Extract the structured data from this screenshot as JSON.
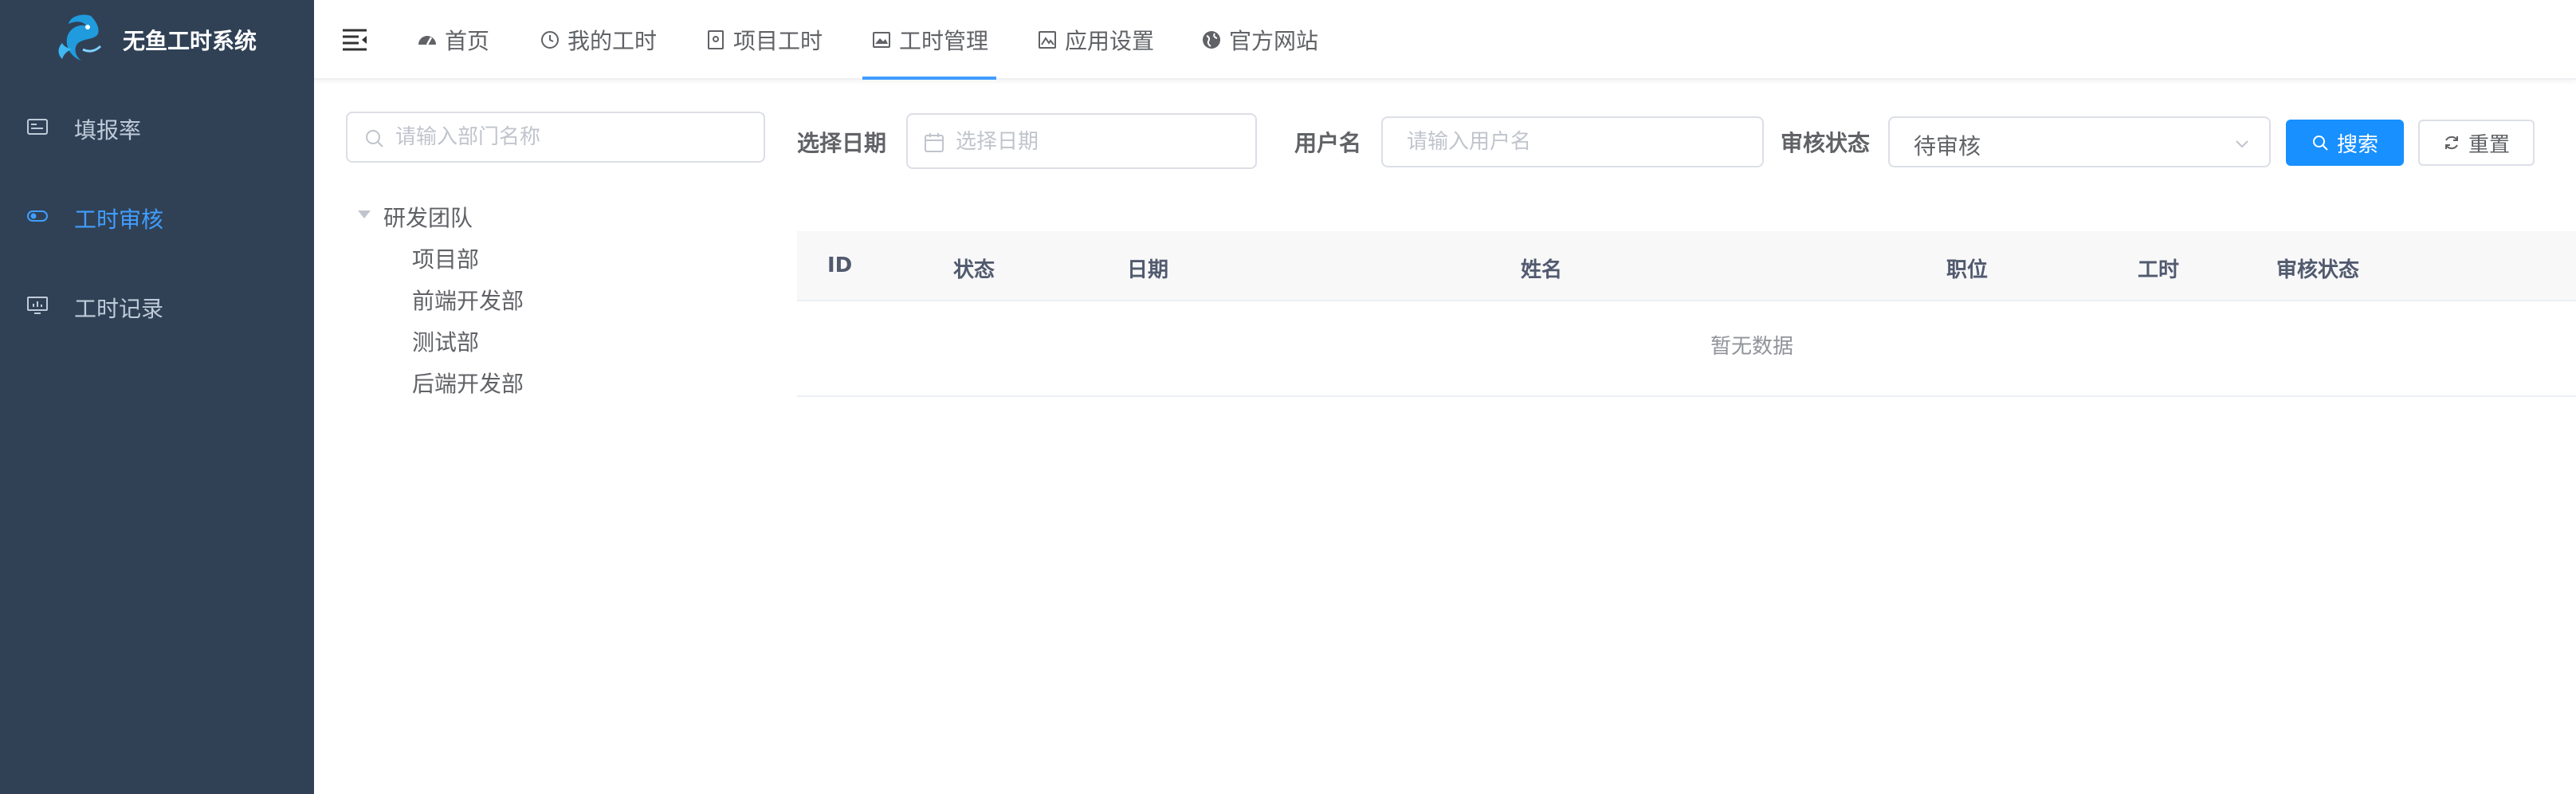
{
  "app": {
    "title": "无鱼工时系统",
    "logo_icon": "fish-logo-icon",
    "colors": {
      "sidebar_bg": "#304156",
      "sidebar_text": "#bfcbd9",
      "accent": "#409eff",
      "primary_button": "#1890ff"
    }
  },
  "sidebar": {
    "items": [
      {
        "label": "填报率",
        "icon": "report-icon",
        "active": false
      },
      {
        "label": "工时审核",
        "icon": "toggle-icon",
        "active": true
      },
      {
        "label": "工时记录",
        "icon": "monitor-chart-icon",
        "active": false
      }
    ]
  },
  "topnav": {
    "menu_toggle_icon": "hamburger-collapse-icon",
    "tabs": [
      {
        "label": "首页",
        "icon": "dashboard-icon",
        "active": false
      },
      {
        "label": "我的工时",
        "icon": "clock-icon",
        "active": false
      },
      {
        "label": "项目工时",
        "icon": "document-icon",
        "active": false
      },
      {
        "label": "工时管理",
        "icon": "image-icon",
        "active": true
      },
      {
        "label": "应用设置",
        "icon": "picture-icon",
        "active": false
      },
      {
        "label": "官方网站",
        "icon": "globe-icon",
        "active": false
      }
    ]
  },
  "dept_tree": {
    "search_placeholder": "请输入部门名称",
    "root": {
      "label": "研发团队",
      "expanded": true
    },
    "children": [
      "项目部",
      "前端开发部",
      "测试部",
      "后端开发部"
    ]
  },
  "filters": {
    "date_label": "选择日期",
    "date_placeholder": "选择日期",
    "username_label": "用户名",
    "username_placeholder": "请输入用户名",
    "status_label": "审核状态",
    "status_value": "待审核",
    "search_button": "搜索",
    "reset_button": "重置"
  },
  "table": {
    "columns": [
      "ID",
      "状态",
      "日期",
      "姓名",
      "职位",
      "工时",
      "审核状态"
    ],
    "rows": [],
    "empty_text": "暂无数据"
  }
}
